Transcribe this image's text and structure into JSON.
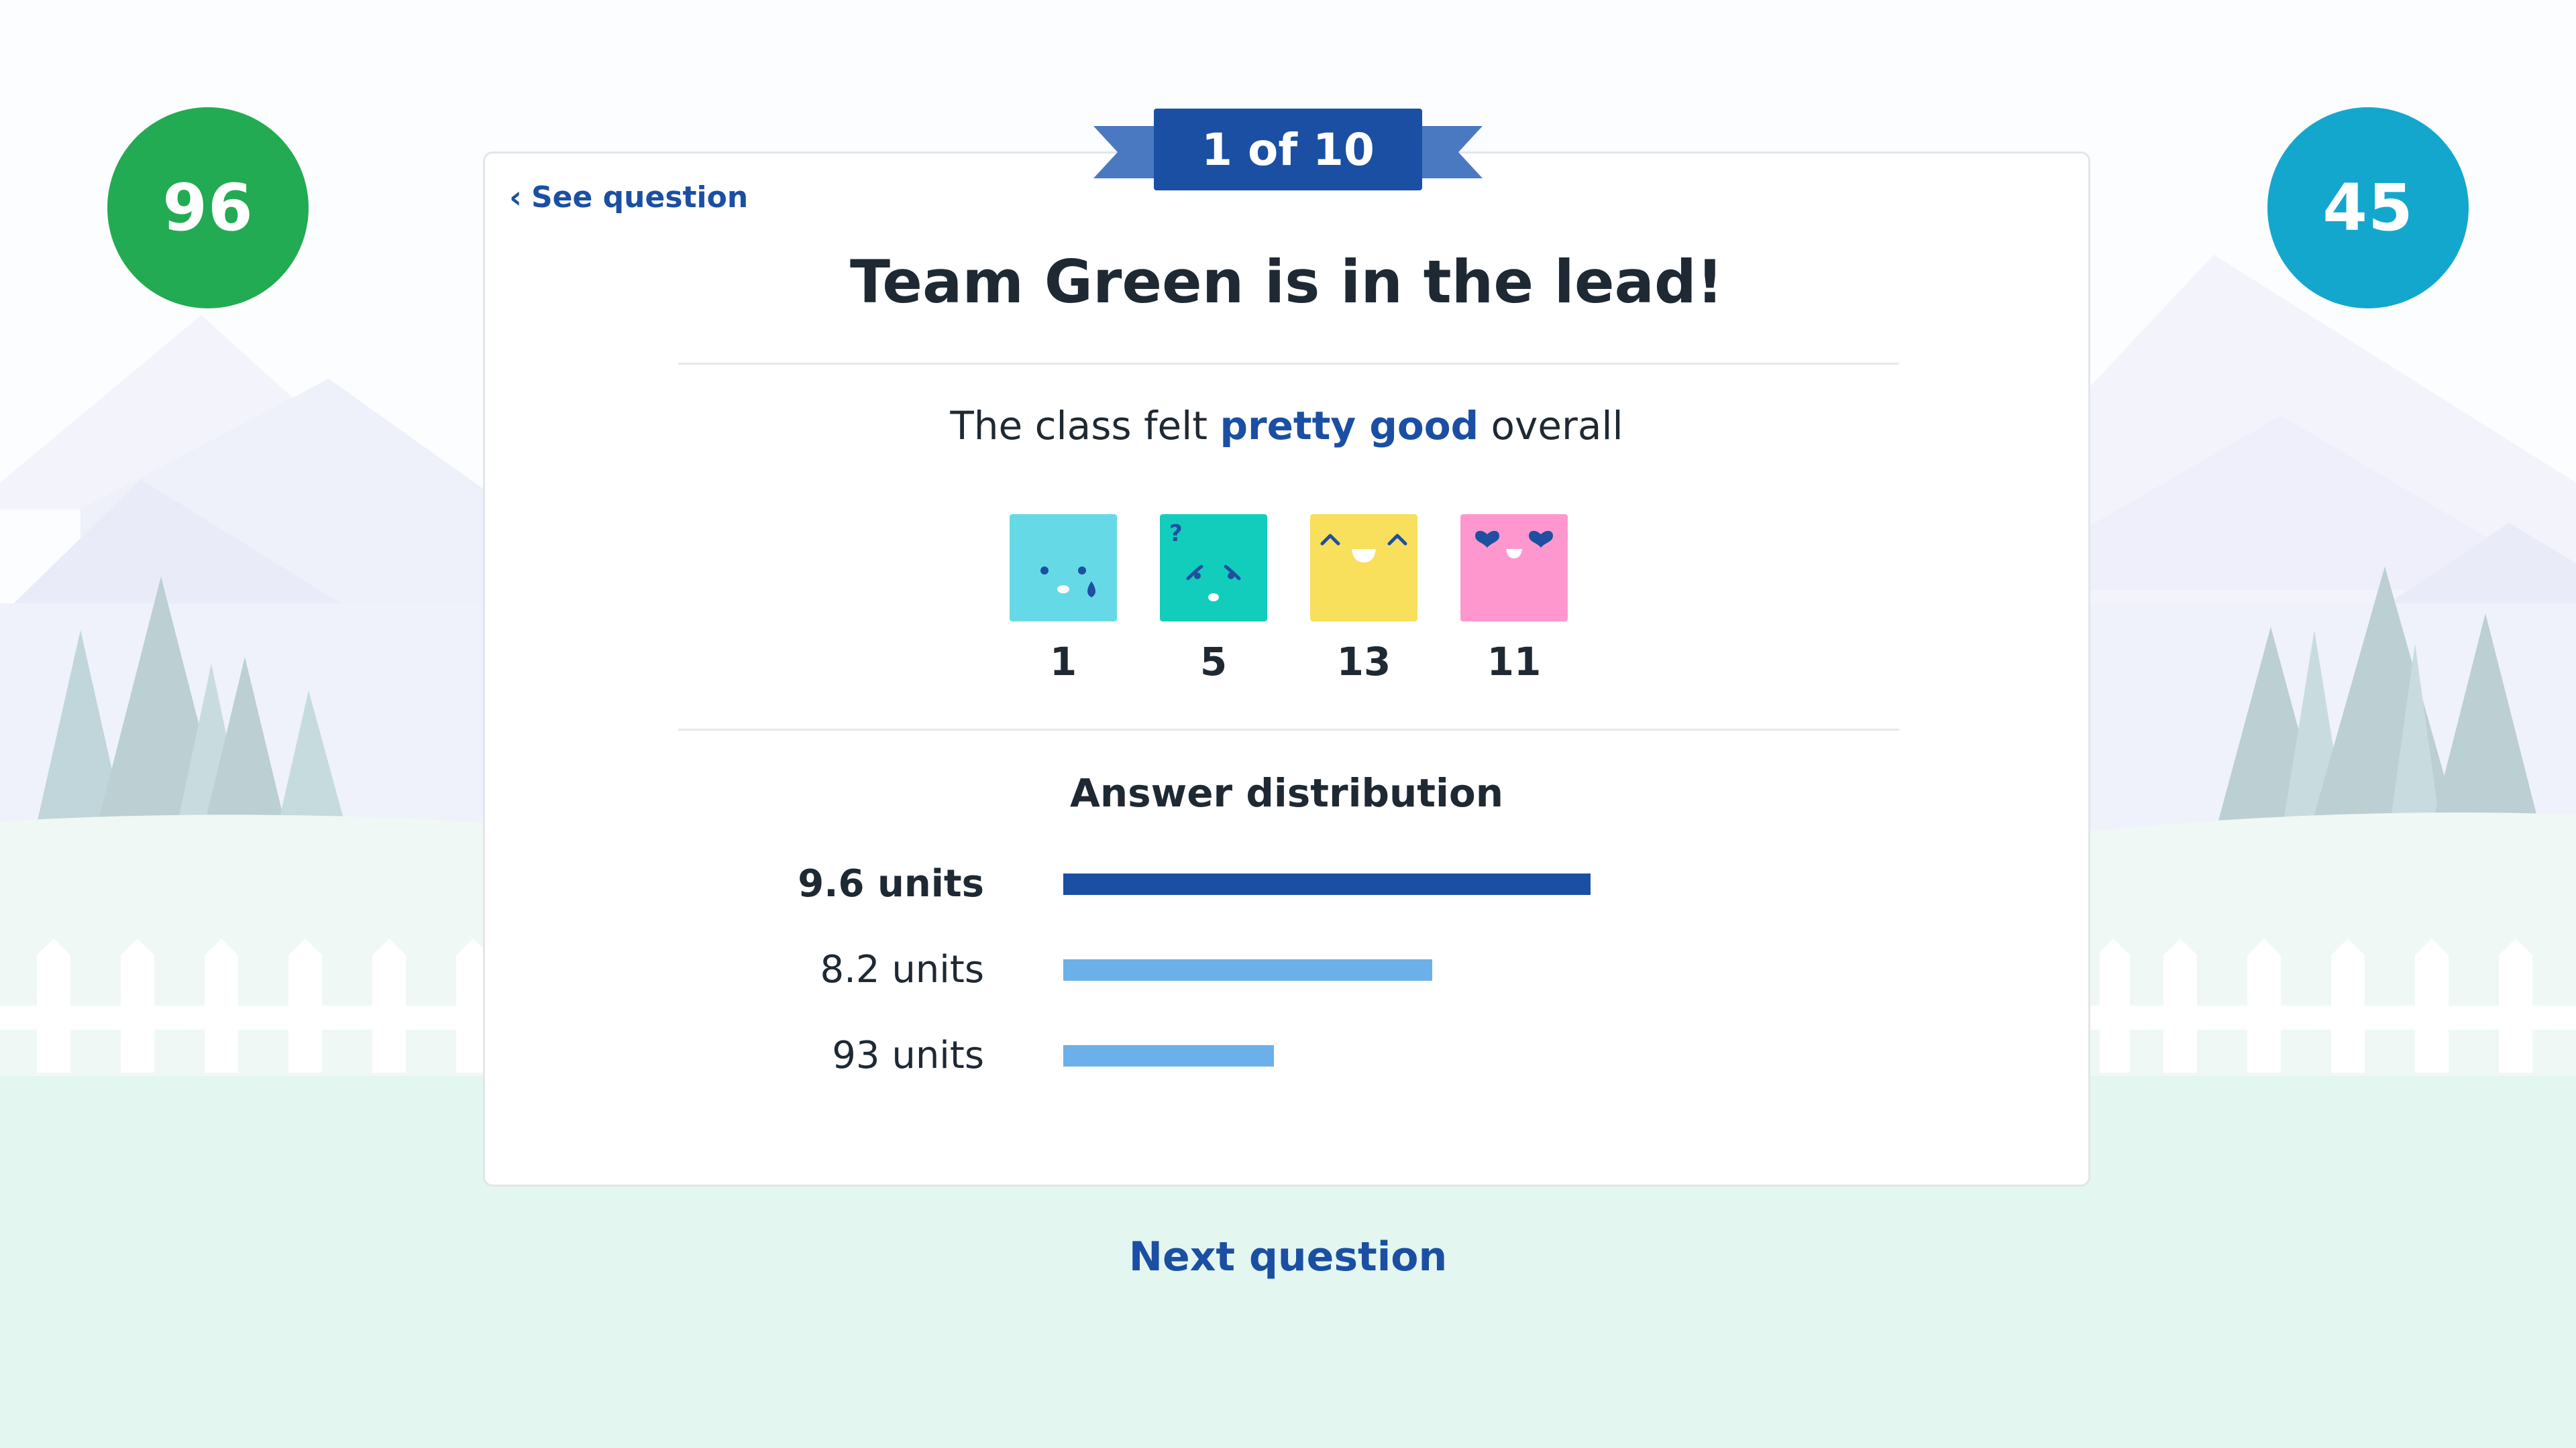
{
  "scores": {
    "team_green": "96",
    "team_blue": "45"
  },
  "card": {
    "progress_label": "1 of 10",
    "see_question_label": "See question",
    "headline": "Team Green is in the lead!",
    "mood_sentence": {
      "prefix": "The class felt ",
      "highlight": "pretty good",
      "suffix": " overall"
    },
    "moods": [
      {
        "icon": "sad-face-icon",
        "color": "#66d9e6",
        "count": "1"
      },
      {
        "icon": "confused-face-icon",
        "color": "#12cdbc",
        "count": "5"
      },
      {
        "icon": "happy-face-icon",
        "color": "#f8df5c",
        "count": "13"
      },
      {
        "icon": "love-face-icon",
        "color": "#ff97cf",
        "count": "11"
      }
    ],
    "distribution": {
      "title": "Answer distribution",
      "rows": [
        {
          "label": "9.6 units",
          "fraction": 1.0,
          "color": "#1a4fa3",
          "bold": true
        },
        {
          "label": "8.2 units",
          "fraction": 0.7,
          "color": "#6cb0ea",
          "bold": false
        },
        {
          "label": "93 units",
          "fraction": 0.4,
          "color": "#6cb0ea",
          "bold": false
        }
      ]
    }
  },
  "footer": {
    "next_question_label": "Next question"
  },
  "colors": {
    "brand_blue": "#1a4fa3",
    "team_green": "#22ab52",
    "team_blue": "#14a7cd"
  }
}
